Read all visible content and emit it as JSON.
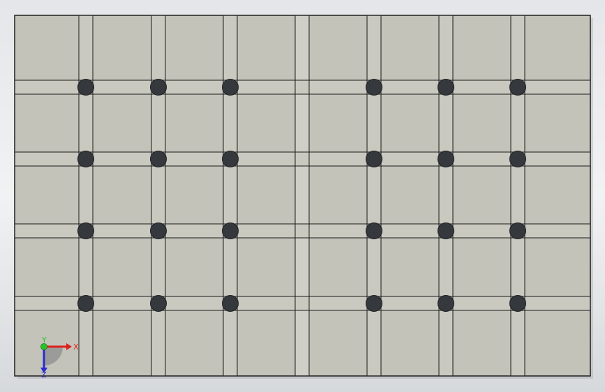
{
  "scene": {
    "part": {
      "face_color": "#c3c3ba",
      "edge_color": "#1a1a1a",
      "groove_color": "#c9c9c0",
      "hole_color": "#35383c",
      "hole_stroke": "#1b1d20",
      "columns_of_holes": 6,
      "rows_of_holes": 4,
      "hole_count": 24
    }
  },
  "triad": {
    "x_label": "X",
    "y_label": "Y",
    "z_label": "Z",
    "x_color": "#e0201c",
    "y_color": "#27c427",
    "z_color": "#2a2ad0"
  }
}
